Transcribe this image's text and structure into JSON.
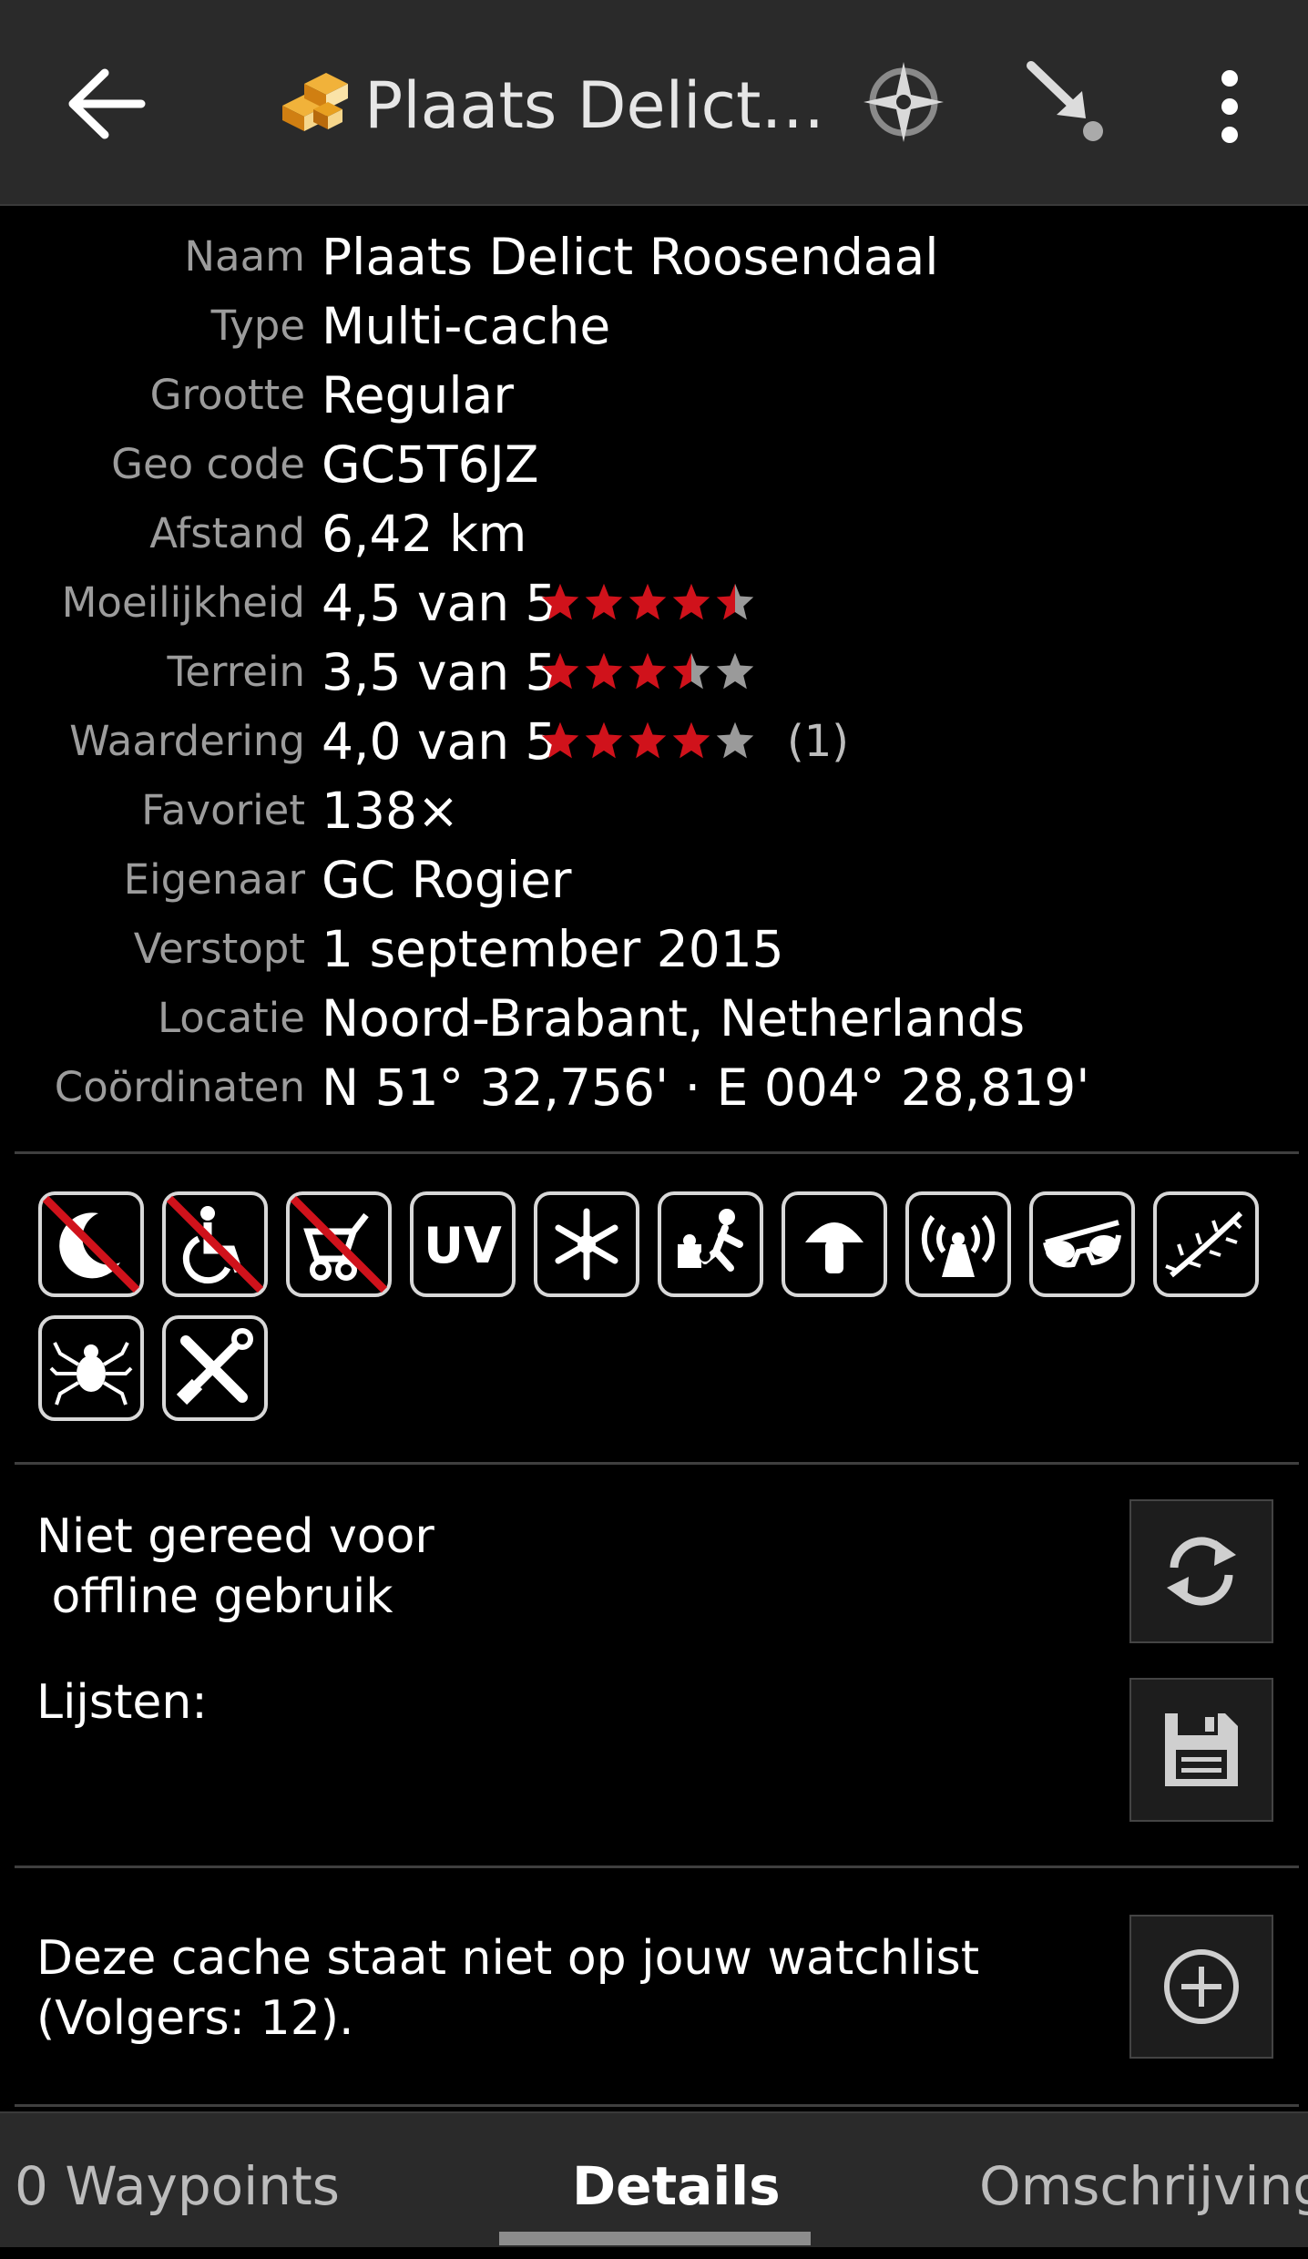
{
  "app_bar": {
    "title": "Plaats Delict…",
    "icons": [
      "back-arrow-icon",
      "cache-type-icon",
      "navigate-icon",
      "direction-icon",
      "more-vert-icon"
    ]
  },
  "details": [
    {
      "label": "Naam",
      "value": "Plaats Delict Roosendaal"
    },
    {
      "label": "Type",
      "value": "Multi-cache"
    },
    {
      "label": "Grootte",
      "value": "Regular"
    },
    {
      "label": "Geo code",
      "value": "GC5T6JZ"
    },
    {
      "label": "Afstand",
      "value": "6,42 km"
    },
    {
      "label": "Moeilijkheid",
      "value": "4,5 van 5",
      "stars": 4.5
    },
    {
      "label": "Terrein",
      "value": "3,5 van 5",
      "stars": 3.5
    },
    {
      "label": "Waardering",
      "value": "4,0 van 5",
      "stars": 4.0,
      "votes": "(1)"
    },
    {
      "label": "Favoriet",
      "value": "138×"
    },
    {
      "label": "Eigenaar",
      "value": "GC Rogier"
    },
    {
      "label": "Verstopt",
      "value": "1 september 2015"
    },
    {
      "label": "Locatie",
      "value": "Noord-Brabant, Netherlands"
    },
    {
      "label": "Coördinaten",
      "value": "N 51° 32,756' · E 004° 28,819'"
    }
  ],
  "attributes": [
    {
      "icon": "night-icon",
      "negated": true
    },
    {
      "icon": "wheelchair-icon",
      "negated": true
    },
    {
      "icon": "stroller-icon",
      "negated": true
    },
    {
      "icon": "uv-light-icon",
      "negated": false,
      "text": "UV"
    },
    {
      "icon": "snowflake-icon",
      "negated": false
    },
    {
      "icon": "field-puzzle-icon",
      "negated": false
    },
    {
      "icon": "mushroom-icon",
      "negated": false
    },
    {
      "icon": "wireless-beacon-icon",
      "negated": false
    },
    {
      "icon": "sunglasses-icon",
      "negated": false
    },
    {
      "icon": "thorns-icon",
      "negated": false
    },
    {
      "icon": "ticks-icon",
      "negated": false
    },
    {
      "icon": "tools-icon",
      "negated": false
    }
  ],
  "offline": {
    "status": "Niet gereed voor\n offline gebruik",
    "lists_label": "Lijsten:"
  },
  "watchlist": {
    "text": "Deze cache staat niet op jouw watchlist\n(Volgers: 12)."
  },
  "tabs": {
    "left": "0 Waypoints",
    "active": "Details",
    "right": "Omschrijving"
  },
  "colors": {
    "background": "#000000",
    "app_bar": "#2a2a2a",
    "label": "#9c9c9c",
    "star_filled": "#d0121b",
    "star_empty": "#9a9a9a"
  }
}
